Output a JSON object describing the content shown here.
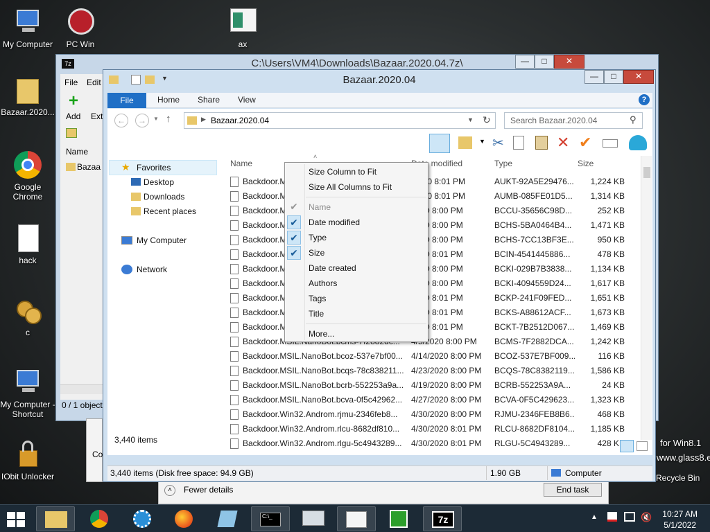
{
  "desktop": {
    "icons": [
      {
        "label": "My Computer"
      },
      {
        "label": "PC Win"
      },
      {
        "label": "ax"
      },
      {
        "label": "Bazaar.2020..."
      },
      {
        "label": "Google Chrome"
      },
      {
        "label": "hack"
      },
      {
        "label": "c"
      },
      {
        "label": "My Computer - Shortcut"
      },
      {
        "label": "IObit Unlocker"
      },
      {
        "label": "Recycle Bin"
      }
    ],
    "watermark_line1": "for Win8.1",
    "watermark_line2": "www.glass8.eu"
  },
  "sevenzip_window": {
    "title": "C:\\Users\\VM4\\Downloads\\Bazaar.2020.04.7z\\",
    "menu_file": "File",
    "menu_edit": "Edit",
    "add_label": "Add",
    "extract_label": "Extr",
    "col_name": "Name",
    "item_name": "Bazaa",
    "status": "0 / 1 object",
    "fewer_details": "Fewer details",
    "end_task": "End task",
    "co_label": "Co"
  },
  "explorer": {
    "title": "Bazaar.2020.04",
    "tabs": {
      "file": "File",
      "home": "Home",
      "share": "Share",
      "view": "View"
    },
    "address": "Bazaar.2020.04",
    "search_placeholder": "Search Bazaar.2020.04",
    "nav": {
      "favorites": "Favorites",
      "desktop": "Desktop",
      "downloads": "Downloads",
      "recent": "Recent places",
      "my_computer": "My Computer",
      "network": "Network"
    },
    "columns": {
      "name": "Name",
      "date": "Date modified",
      "type": "Type",
      "size": "Size"
    },
    "rows": [
      {
        "name": "Backdoor.M",
        "date": "/2020 8:01 PM",
        "type": "AUKT-92A5E29476...",
        "size": "1,224 KB"
      },
      {
        "name": "Backdoor.M",
        "date": "/2020 8:01 PM",
        "type": "AUMB-085FE01D5...",
        "size": "1,314 KB"
      },
      {
        "name": "Backdoor.M",
        "date": "2020 8:00 PM",
        "type": "BCCU-35656C98D...",
        "size": "252 KB"
      },
      {
        "name": "Backdoor.M",
        "date": "2020 8:00 PM",
        "type": "BCHS-5BA0464B4...",
        "size": "1,471 KB"
      },
      {
        "name": "Backdoor.M",
        "date": "2020 8:00 PM",
        "type": "BCHS-7CC13BF3E...",
        "size": "950 KB"
      },
      {
        "name": "Backdoor.M",
        "date": "2020 8:01 PM",
        "type": "BCIN-4541445886...",
        "size": "478 KB"
      },
      {
        "name": "Backdoor.M",
        "date": "2020 8:00 PM",
        "type": "BCKI-029B7B3838...",
        "size": "1,134 KB"
      },
      {
        "name": "Backdoor.M",
        "date": "2020 8:00 PM",
        "type": "BCKI-4094559D24...",
        "size": "1,617 KB"
      },
      {
        "name": "Backdoor.M",
        "date": "2020 8:01 PM",
        "type": "BCKP-241F09FED...",
        "size": "1,651 KB"
      },
      {
        "name": "Backdoor.M",
        "date": "2020 8:01 PM",
        "type": "BCKS-A88612ACF...",
        "size": "1,673 KB"
      },
      {
        "name": "Backdoor.M",
        "date": "2020 8:01 PM",
        "type": "BCKT-7B2512D067...",
        "size": "1,469 KB"
      },
      {
        "name": "Backdoor.MSIL.NanoBot.bcms-7f2882dc...",
        "date": "4/5/2020 8:00 PM",
        "type": "BCMS-7F2882DCA...",
        "size": "1,242 KB"
      },
      {
        "name": "Backdoor.MSIL.NanoBot.bcoz-537e7bf00...",
        "date": "4/14/2020 8:00 PM",
        "type": "BCOZ-537E7BF009...",
        "size": "116 KB"
      },
      {
        "name": "Backdoor.MSIL.NanoBot.bcqs-78c838211...",
        "date": "4/23/2020 8:00 PM",
        "type": "BCQS-78C8382119...",
        "size": "1,586 KB"
      },
      {
        "name": "Backdoor.MSIL.NanoBot.bcrb-552253a9a...",
        "date": "4/19/2020 8:00 PM",
        "type": "BCRB-552253A9A...",
        "size": "24 KB"
      },
      {
        "name": "Backdoor.MSIL.NanoBot.bcva-0f5c42962...",
        "date": "4/27/2020 8:00 PM",
        "type": "BCVA-0F5C429623...",
        "size": "1,323 KB"
      },
      {
        "name": "Backdoor.Win32.Androm.rjmu-2346feb8...",
        "date": "4/30/2020 8:00 PM",
        "type": "RJMU-2346FEB8B6...",
        "size": "468 KB"
      },
      {
        "name": "Backdoor.Win32.Androm.rlcu-8682df810...",
        "date": "4/30/2020 8:01 PM",
        "type": "RLCU-8682DF8104...",
        "size": "1,185 KB"
      },
      {
        "name": "Backdoor.Win32.Androm.rlgu-5c4943289...",
        "date": "4/30/2020 8:01 PM",
        "type": "RLGU-5C4943289...",
        "size": "428 KB"
      }
    ],
    "item_count": "3,440 items",
    "status_left": "3,440 items (Disk free space: 94.9 GB)",
    "status_size": "1.90 GB",
    "status_location": "Computer"
  },
  "context_menu": {
    "size_column": "Size Column to Fit",
    "size_all": "Size All Columns to Fit",
    "name": "Name",
    "date_modified": "Date modified",
    "type": "Type",
    "size": "Size",
    "date_created": "Date created",
    "authors": "Authors",
    "tags": "Tags",
    "title": "Title",
    "more": "More..."
  },
  "taskbar": {
    "time": "10:27 AM",
    "date": "5/1/2022",
    "sevenzip_label": "7z"
  },
  "colors": {
    "accent": "#1f6fc6",
    "close": "#c74a3c",
    "taskbar": "#1c2a36"
  }
}
